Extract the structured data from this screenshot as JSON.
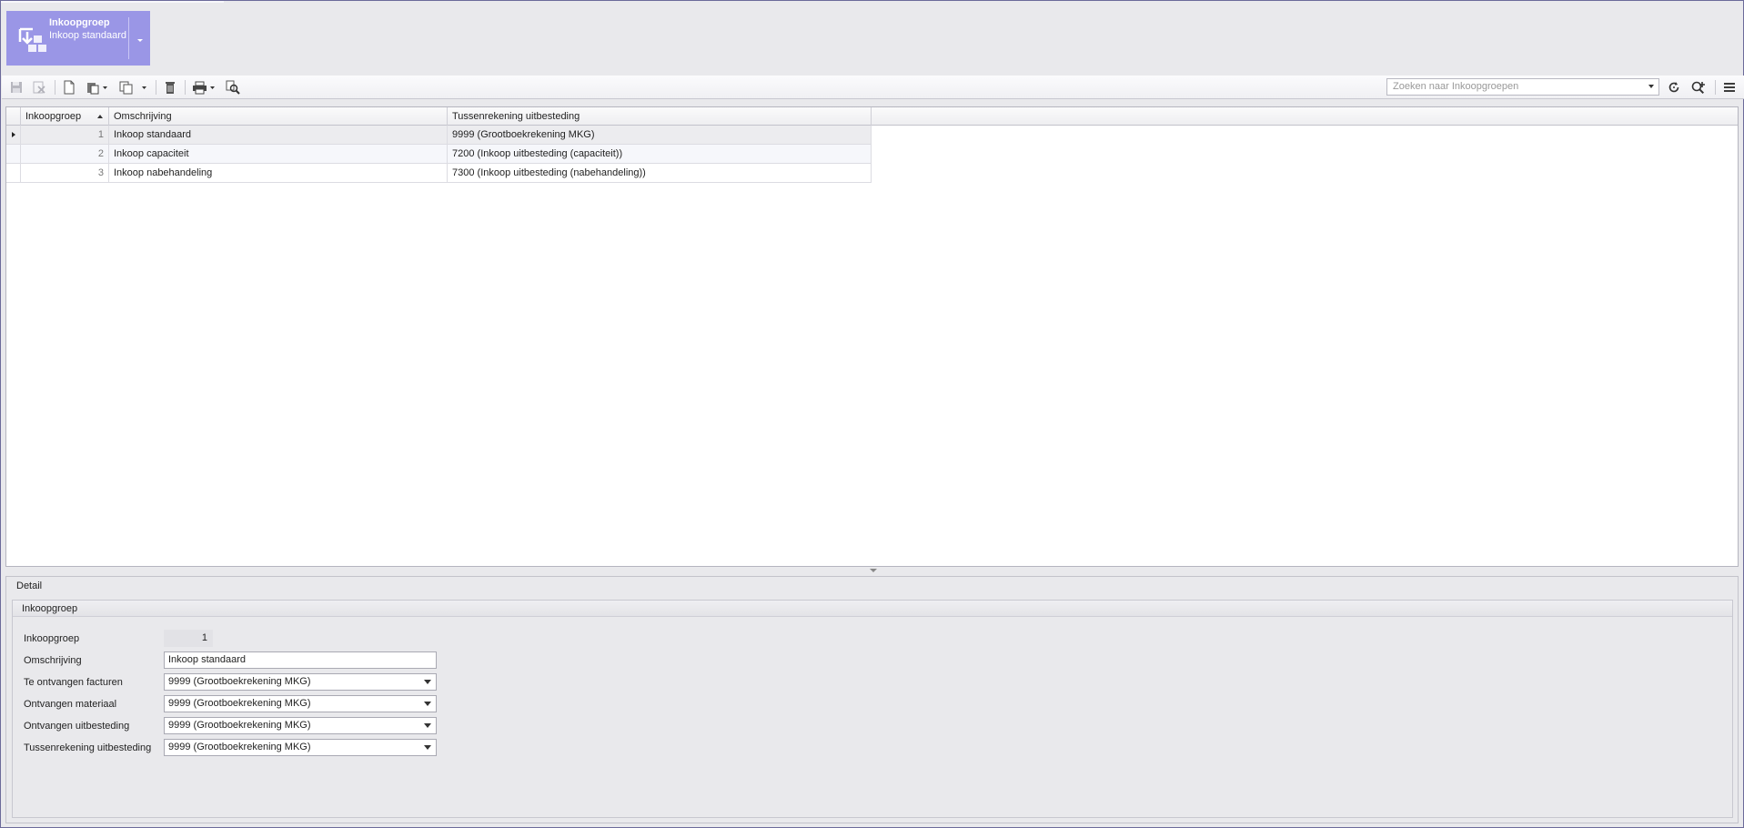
{
  "header": {
    "title": "Inkoopgroep",
    "subtitle": "Inkoop standaard",
    "accent_color": "#9a96e6"
  },
  "toolbar": {
    "icons": [
      "save-icon",
      "discard-icon",
      "new-icon",
      "paste-icon",
      "copy-icon",
      "delete-icon",
      "print-icon",
      "preview-icon",
      "refresh-icon",
      "zoom-add-icon",
      "menu-icon"
    ],
    "search_placeholder": "Zoeken naar Inkoopgroepen"
  },
  "grid": {
    "columns": [
      "Inkoopgroep",
      "Omschrijving",
      "Tussenrekening uitbesteding"
    ],
    "rows": [
      {
        "id": "1",
        "omschrijving": "Inkoop standaard",
        "tussenrekening": "9999 (Grootboekrekening MKG)"
      },
      {
        "id": "2",
        "omschrijving": "Inkoop capaciteit",
        "tussenrekening": "7200 (Inkoop uitbesteding (capaciteit))"
      },
      {
        "id": "3",
        "omschrijving": "Inkoop nabehandeling",
        "tussenrekening": "7300 (Inkoop uitbesteding (nabehandeling))"
      }
    ]
  },
  "detail": {
    "title": "Detail",
    "group_title": "Inkoopgroep",
    "fields": {
      "inkoopgroep": {
        "label": "Inkoopgroep",
        "value": "1"
      },
      "omschrijving": {
        "label": "Omschrijving",
        "value": "Inkoop standaard"
      },
      "te_ontvangen": {
        "label": "Te ontvangen facturen",
        "value": "9999 (Grootboekrekening MKG)"
      },
      "ontvangen_materiaal": {
        "label": "Ontvangen materiaal",
        "value": "9999 (Grootboekrekening MKG)"
      },
      "ontvangen_uitbesteding": {
        "label": "Ontvangen uitbesteding",
        "value": "9999 (Grootboekrekening MKG)"
      },
      "tussenrekening": {
        "label": "Tussenrekening uitbesteding",
        "value": "9999 (Grootboekrekening MKG)"
      }
    }
  }
}
